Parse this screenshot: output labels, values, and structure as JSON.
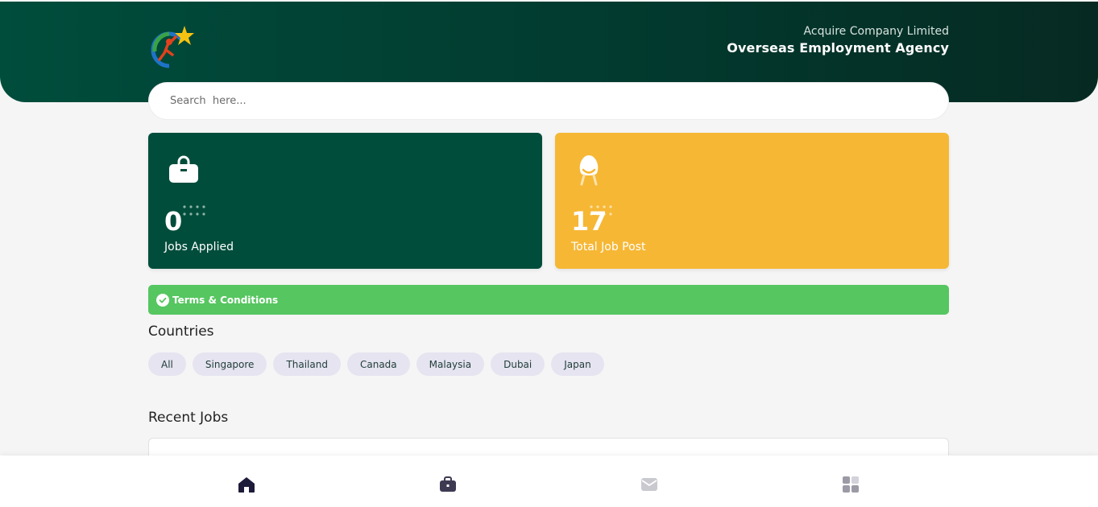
{
  "header": {
    "company_sub": "Acquire Company Limited",
    "company_main": "Overseas Employment Agency"
  },
  "search": {
    "placeholder": "Search  here..."
  },
  "stats": [
    {
      "value": "0",
      "label": "Jobs Applied",
      "icon": "shopping-bag-icon",
      "color": "#004d3c"
    },
    {
      "value": "17",
      "label": "Total Job Post",
      "icon": "chair-icon",
      "color": "#f6b735"
    }
  ],
  "terms": {
    "label": "Terms & Conditions",
    "color": "#56c660"
  },
  "countries": {
    "title": "Countries",
    "items": [
      "All",
      "Singapore",
      "Thailand",
      "Canada",
      "Malaysia",
      "Dubai",
      "Japan"
    ]
  },
  "recent_jobs": {
    "title": "Recent Jobs"
  },
  "bottom_nav": {
    "items": [
      {
        "icon": "home-icon",
        "active": true
      },
      {
        "icon": "briefcase-icon",
        "active": false
      },
      {
        "icon": "mail-icon",
        "active": false
      },
      {
        "icon": "grid-icon",
        "active": false
      }
    ]
  }
}
